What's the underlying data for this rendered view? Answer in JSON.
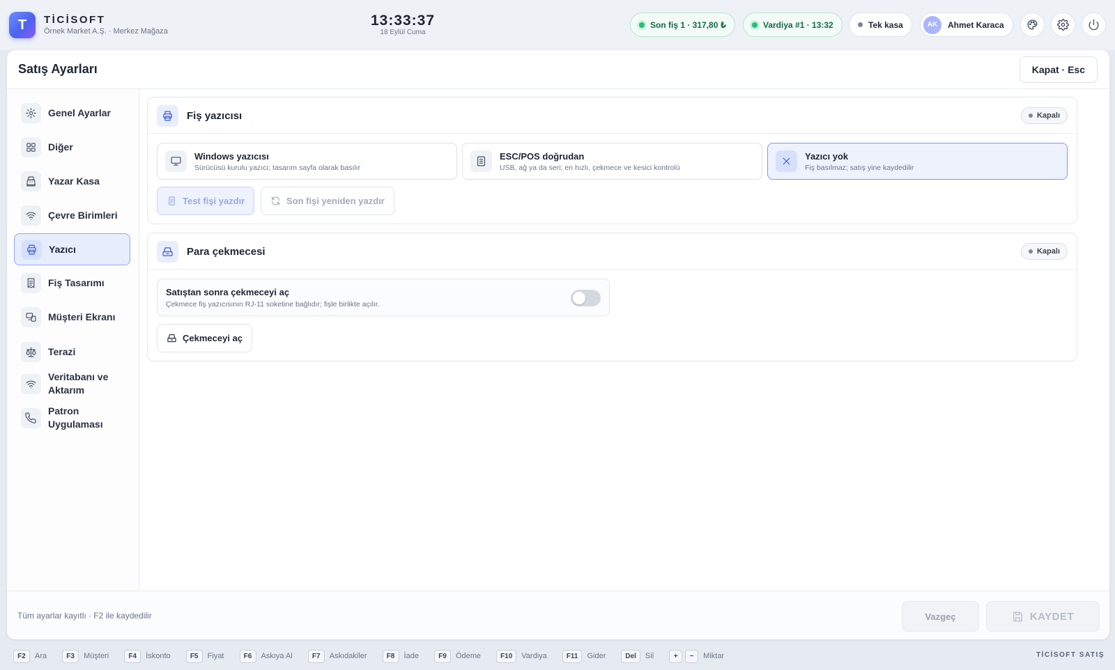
{
  "brand": {
    "logo_letter": "T",
    "name": "TİCİSOFT",
    "subtitle": "Örnek Market A.Ş. · Merkez Mağaza"
  },
  "clock": {
    "time": "13:33:37",
    "date": "18 Eylül Cuma"
  },
  "status_pills": {
    "last_receipt": "Son fiş 1 · 317,80 ₺",
    "shift": "Vardiya #1 · 13:32",
    "register": "Tek kasa"
  },
  "user": {
    "initials": "AK",
    "name": "Ahmet Karaca"
  },
  "panel": {
    "title": "Satış Ayarları",
    "close_label": "Kapat · Esc"
  },
  "sidebar": {
    "items": [
      {
        "label": "Genel Ayarlar",
        "icon": "gear-icon"
      },
      {
        "label": "Diğer",
        "icon": "grid-icon"
      },
      {
        "label": "Yazar Kasa",
        "icon": "cash-register-icon"
      },
      {
        "label": "Çevre Birimleri",
        "icon": "wifi-icon"
      },
      {
        "label": "Yazıcı",
        "icon": "printer-icon",
        "active": true
      },
      {
        "label": "Fiş Tasarımı",
        "icon": "receipt-icon"
      },
      {
        "label": "Müşteri Ekranı",
        "icon": "display-icon"
      },
      {
        "label": "Terazi",
        "icon": "scale-icon"
      },
      {
        "label": "Veritabanı ve Aktarım",
        "icon": "wifi-icon"
      },
      {
        "label": "Patron Uygulaması",
        "icon": "phone-icon"
      }
    ]
  },
  "receipt_printer": {
    "title": "Fiş yazıcısı",
    "status": "Kapalı",
    "options": [
      {
        "title": "Windows yazıcısı",
        "desc": "Sürücüsü kurulu yazıcı; tasarım sayfa olarak basılır",
        "icon": "monitor-icon"
      },
      {
        "title": "ESC/POS doğrudan",
        "desc": "USB, ağ ya da seri; en hızlı, çekmece ve kesici kontrolü",
        "icon": "document-icon"
      },
      {
        "title": "Yazıcı yok",
        "desc": "Fiş basılmaz; satış yine kaydedilir",
        "icon": "x-icon",
        "selected": true
      }
    ],
    "test_button": "Test fişi yazdır",
    "reprint_button": "Son fişi yeniden yazdır"
  },
  "cash_drawer": {
    "title": "Para çekmecesi",
    "status": "Kapalı",
    "toggle_title": "Satıştan sonra çekmeceyi aç",
    "toggle_desc": "Çekmece fiş yazıcısının RJ-11 soketine bağlıdır; fişle birlikte açılır.",
    "toggle_on": false,
    "open_button": "Çekmeceyi aç"
  },
  "footer": {
    "note": "Tüm ayarlar kayıtlı · F2 ile kaydedilir",
    "cancel": "Vazgeç",
    "save": "KAYDET"
  },
  "shortcuts": [
    {
      "key": "F2",
      "label": "Ara"
    },
    {
      "key": "F3",
      "label": "Müşteri"
    },
    {
      "key": "F4",
      "label": "İskonto"
    },
    {
      "key": "F5",
      "label": "Fiyat"
    },
    {
      "key": "F6",
      "label": "Askıya Al"
    },
    {
      "key": "F7",
      "label": "Askıdakiler"
    },
    {
      "key": "F8",
      "label": "İade"
    },
    {
      "key": "F9",
      "label": "Ödeme"
    },
    {
      "key": "F10",
      "label": "Vardiya"
    },
    {
      "key": "F11",
      "label": "Gider"
    },
    {
      "key": "Del",
      "label": "Sil"
    }
  ],
  "qty_shortcut": {
    "plus": "+",
    "minus": "−",
    "label": "Miktar"
  },
  "footer_brand": "TİCİSOFT SATIŞ"
}
